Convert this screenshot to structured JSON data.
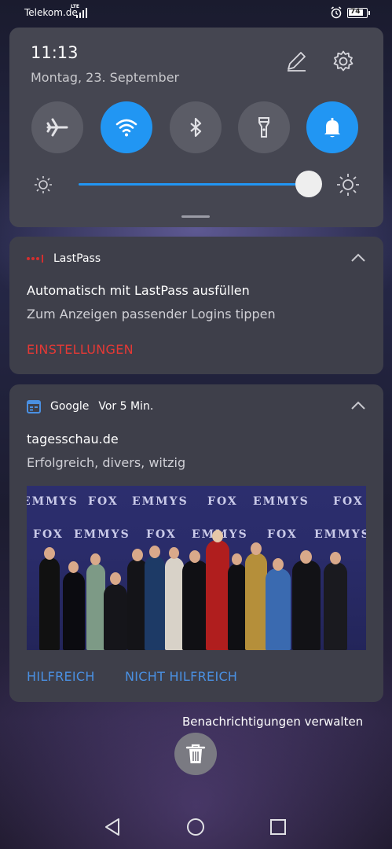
{
  "status_bar": {
    "carrier": "Telekom.de",
    "network": "LTE",
    "battery": "74",
    "icons": [
      "signal-icon",
      "alarm-icon",
      "battery-icon"
    ]
  },
  "quick_settings": {
    "time": "11:13",
    "date": "Montag, 23. September",
    "tiles": [
      {
        "name": "airplane-mode",
        "on": false
      },
      {
        "name": "wifi",
        "on": true
      },
      {
        "name": "bluetooth",
        "on": false
      },
      {
        "name": "flashlight",
        "on": false
      },
      {
        "name": "sound",
        "on": true
      }
    ],
    "brightness_level": 0.9,
    "accent": "#2196f3"
  },
  "notifications": [
    {
      "app": "LastPass",
      "title": "Automatisch mit LastPass ausfüllen",
      "text": "Zum Anzeigen passender Logins tippen",
      "actions": [
        "EINSTELLUNGEN"
      ]
    },
    {
      "app": "Google",
      "time": "Vor 5 Min.",
      "title": "tagesschau.de",
      "text": "Erfolgreich, divers, witzig",
      "image_text": [
        "EMMYS",
        "FOX"
      ],
      "actions": [
        "HILFREICH",
        "NICHT HILFREICH"
      ]
    }
  ],
  "manage_label": "Benachrichtigungen verwalten",
  "colors": {
    "panel": "#454651",
    "card": "#3e3f4a",
    "action_red": "#e53935",
    "action_blue": "#4a90e2"
  }
}
